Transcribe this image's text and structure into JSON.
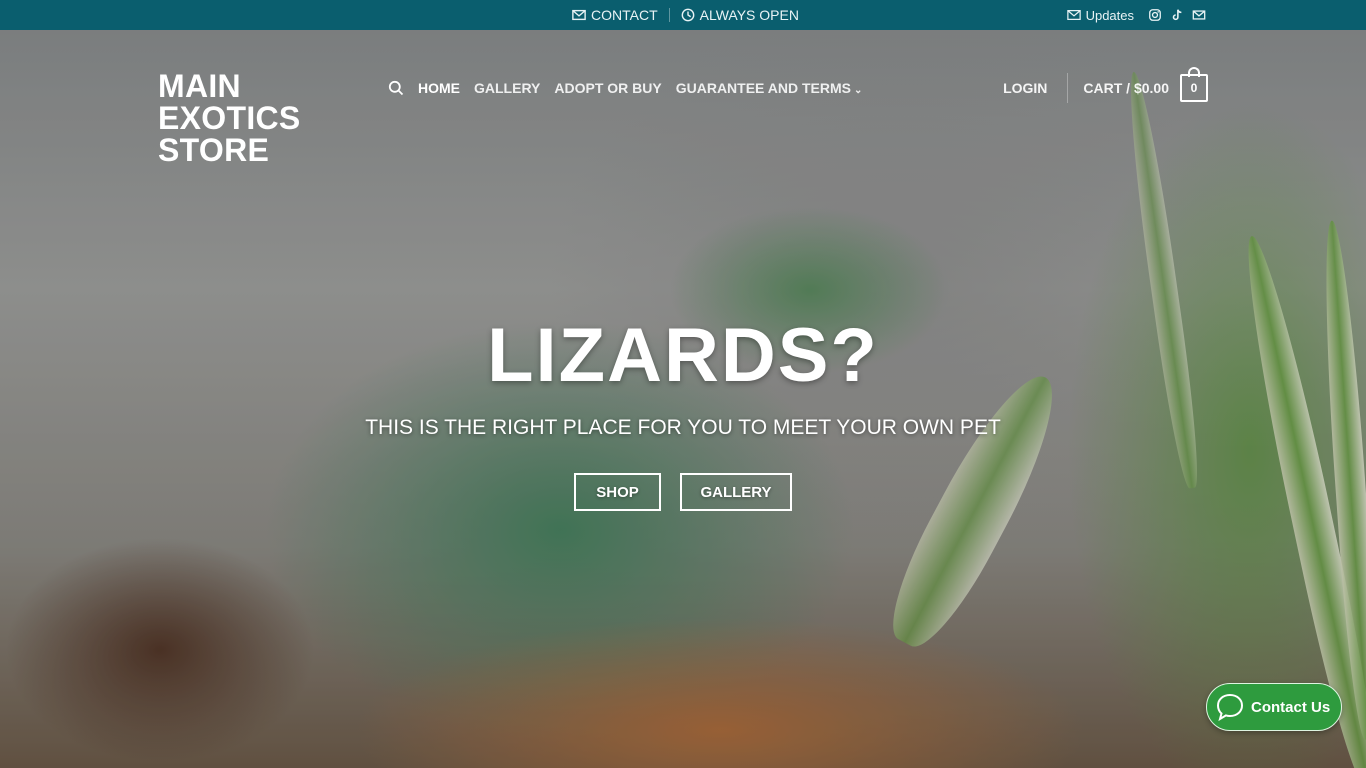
{
  "topbar": {
    "contact_label": "CONTACT",
    "hours_label": "ALWAYS OPEN",
    "updates_label": "Updates",
    "social_icons": [
      "instagram-icon",
      "tiktok-icon",
      "email-icon"
    ]
  },
  "header": {
    "logo_lines": [
      "MAIN",
      "EXOTICS",
      "STORE"
    ],
    "nav": [
      {
        "label": "HOME",
        "active": true
      },
      {
        "label": "GALLERY"
      },
      {
        "label": "ADOPT OR BUY"
      },
      {
        "label": "GUARANTEE AND TERMS",
        "has_dropdown": true
      }
    ],
    "login_label": "LOGIN",
    "cart_label": "CART / $0.00",
    "cart_count": "0"
  },
  "hero": {
    "headline": "LIZARDS?",
    "subline": "THIS IS THE RIGHT PLACE FOR YOU TO MEET YOUR OWN PET",
    "buttons": [
      "SHOP",
      "GALLERY"
    ]
  },
  "widget": {
    "contact_label": "Contact Us",
    "color": "#2e9b3e"
  },
  "colors": {
    "topbar": "#0a5e6e",
    "text_light": "#ffffff"
  }
}
